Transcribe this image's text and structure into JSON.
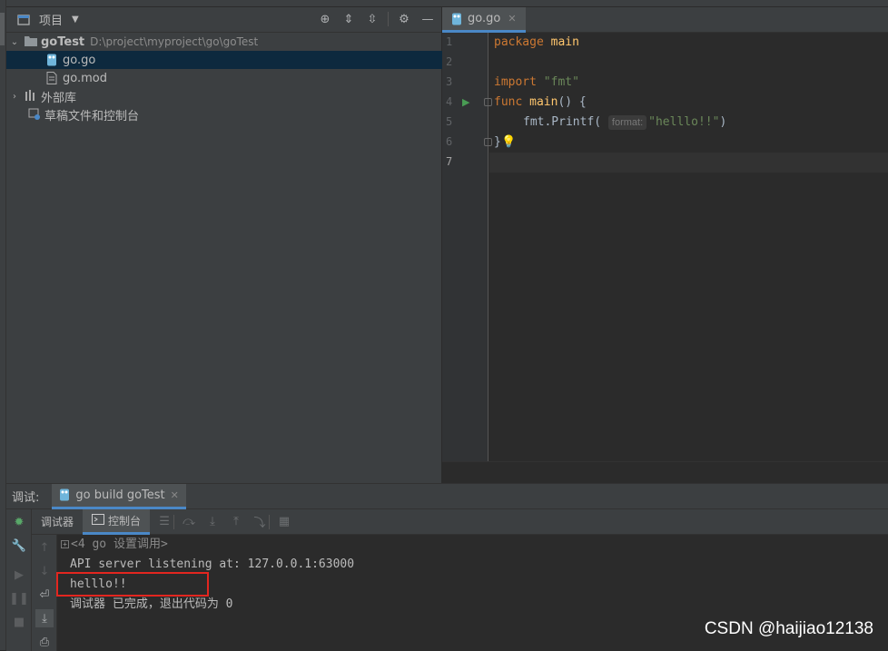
{
  "project": {
    "title": "项目",
    "root_name": "goTest",
    "root_path": "D:\\project\\myproject\\go\\goTest",
    "files": [
      "go.go",
      "go.mod"
    ],
    "external_libs": "外部库",
    "scratches": "草稿文件和控制台"
  },
  "editor": {
    "tab_label": "go.go",
    "line_numbers": [
      "1",
      "2",
      "3",
      "4",
      "5",
      "6",
      "7"
    ],
    "code": {
      "l1_kw": "package",
      "l1_name": "main",
      "l3_kw": "import",
      "l3_str": "\"fmt\"",
      "l4_kw": "func",
      "l4_fn": "main",
      "l4_rest": "() {",
      "l5_pre": "fmt.Printf(",
      "l5_hint": "format:",
      "l5_str": "\"helllo!!\"",
      "l5_post": ")",
      "l6": "}"
    }
  },
  "debug": {
    "label": "调试:",
    "run_tab": "go build goTest",
    "subtab_debugger": "调试器",
    "subtab_console": "控制台",
    "console_lines": [
      "<4 go 设置调用>",
      "API server listening at: 127.0.0.1:63000",
      "helllo!!",
      "调试器 已完成，退出代码为 0"
    ]
  },
  "watermark": "CSDN @haijiao12138",
  "colors": {
    "accent": "#4a88c7",
    "highlight": "#e3261f"
  }
}
